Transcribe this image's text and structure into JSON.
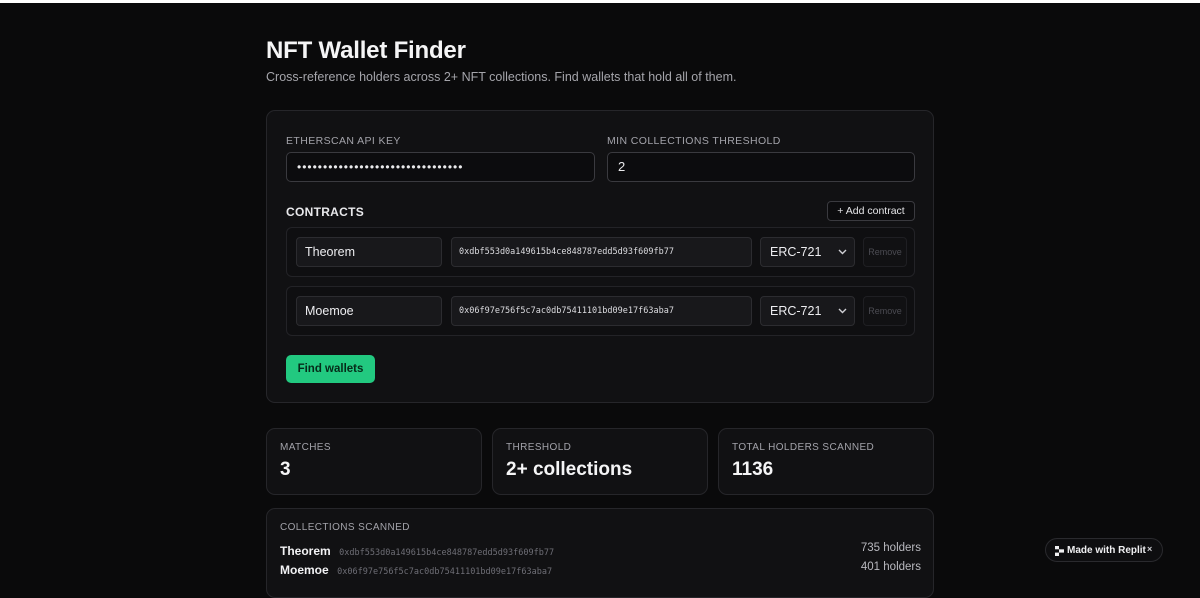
{
  "header": {
    "title": "NFT Wallet Finder",
    "subtitle": "Cross-reference holders across 2+ NFT collections. Find wallets that hold all of them."
  },
  "form": {
    "api_key_label": "ETHERSCAN API KEY",
    "api_key_value": "••••••••••••••••••••••••••••••••",
    "threshold_label": "MIN COLLECTIONS THRESHOLD",
    "threshold_value": "2",
    "contracts_label": "CONTRACTS",
    "add_contract_label": "+ Add contract",
    "contracts": [
      {
        "name": "Theorem",
        "address": "0xdbf553d0a149615b4ce848787edd5d93f609fb77",
        "type": "ERC-721",
        "remove_label": "Remove"
      },
      {
        "name": "Moemoe",
        "address": "0x06f97e756f5c7ac0db75411101bd09e17f63aba7",
        "type": "ERC-721",
        "remove_label": "Remove"
      }
    ],
    "find_label": "Find wallets"
  },
  "stats": [
    {
      "label": "MATCHES",
      "value": "3"
    },
    {
      "label": "THRESHOLD",
      "value": "2+ collections"
    },
    {
      "label": "TOTAL HOLDERS SCANNED",
      "value": "1136"
    }
  ],
  "collections": {
    "title": "COLLECTIONS SCANNED",
    "items": [
      {
        "name": "Theorem",
        "address": "0xdbf553d0a149615b4ce848787edd5d93f609fb77",
        "holders": "735 holders"
      },
      {
        "name": "Moemoe",
        "address": "0x06f97e756f5c7ac0db75411101bd09e17f63aba7",
        "holders": "401 holders"
      }
    ]
  },
  "badge": {
    "label": "Made with Replit",
    "close": "×"
  },
  "colors": {
    "accent": "#22c980",
    "background": "#0a0a0b",
    "card": "#111113"
  }
}
